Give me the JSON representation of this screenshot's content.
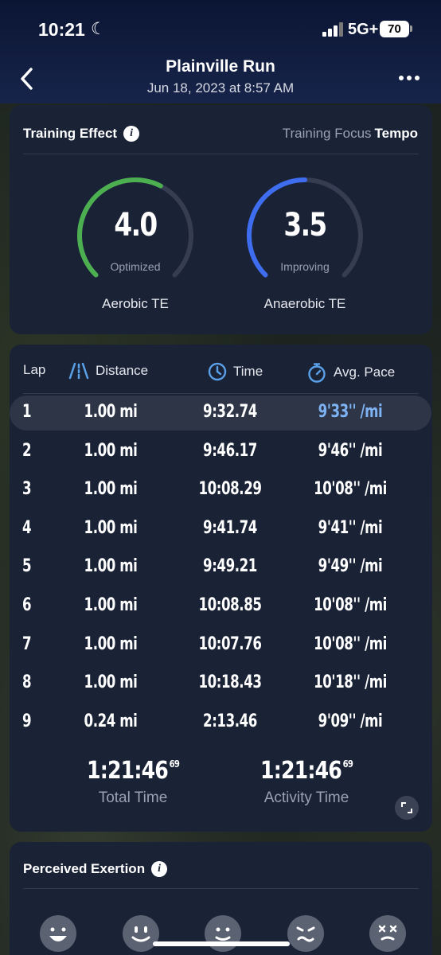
{
  "status_bar": {
    "time": "10:21",
    "network": "5G+",
    "battery": "70"
  },
  "nav": {
    "title": "Plainville Run",
    "subtitle": "Jun 18, 2023 at 8:57 AM"
  },
  "training_effect": {
    "title": "Training Effect",
    "focus_label": "Training Focus",
    "focus_value": "Tempo",
    "aerobic": {
      "value": "4.0",
      "status": "Optimized",
      "label": "Aerobic TE",
      "fill": 0.6,
      "color": "#4cb050"
    },
    "anaerobic": {
      "value": "3.5",
      "status": "Improving",
      "label": "Anaerobic TE",
      "fill": 0.5,
      "color": "#3f6df0"
    },
    "track_color": "#363d52"
  },
  "laps": {
    "headers": {
      "lap": "Lap",
      "distance": "Distance",
      "time": "Time",
      "pace": "Avg. Pace"
    },
    "rows": [
      {
        "lap": "1",
        "distance": "1.00 mi",
        "time": "9:32.74",
        "pace": "9'33'' /mi",
        "selected": true
      },
      {
        "lap": "2",
        "distance": "1.00 mi",
        "time": "9:46.17",
        "pace": "9'46'' /mi"
      },
      {
        "lap": "3",
        "distance": "1.00 mi",
        "time": "10:08.29",
        "pace": "10'08'' /mi"
      },
      {
        "lap": "4",
        "distance": "1.00 mi",
        "time": "9:41.74",
        "pace": "9'41'' /mi"
      },
      {
        "lap": "5",
        "distance": "1.00 mi",
        "time": "9:49.21",
        "pace": "9'49'' /mi"
      },
      {
        "lap": "6",
        "distance": "1.00 mi",
        "time": "10:08.85",
        "pace": "10'08'' /mi"
      },
      {
        "lap": "7",
        "distance": "1.00 mi",
        "time": "10:07.76",
        "pace": "10'08'' /mi"
      },
      {
        "lap": "8",
        "distance": "1.00 mi",
        "time": "10:18.43",
        "pace": "10'18'' /mi"
      },
      {
        "lap": "9",
        "distance": "0.24 mi",
        "time": "2:13.46",
        "pace": "9'09'' /mi"
      }
    ],
    "total_time": {
      "value": "1:21:46",
      "fraction": "69",
      "label": "Total Time"
    },
    "activity_time": {
      "value": "1:21:46",
      "fraction": "69",
      "label": "Activity Time"
    }
  },
  "perceived_exertion": {
    "title": "Perceived Exertion",
    "faces": [
      "very-happy-face-icon",
      "happy-face-icon",
      "smile-face-icon",
      "strained-face-icon",
      "exhausted-face-icon"
    ]
  },
  "colors": {
    "accent_blue": "#5aa0e8",
    "selected_pace": "#7eb3f3"
  }
}
